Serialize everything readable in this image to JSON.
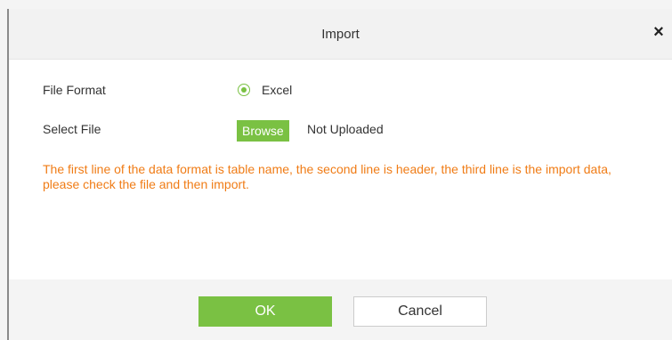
{
  "dialog": {
    "title": "Import",
    "close_symbol": "×"
  },
  "form": {
    "file_format": {
      "label": "File Format",
      "options": [
        {
          "label": "Excel",
          "selected": true
        }
      ]
    },
    "select_file": {
      "label": "Select File",
      "browse_label": "Browse",
      "status": "Not Uploaded"
    }
  },
  "hint": "The first line of the data format is table name, the second line is header, the third line is the import data, please check the file and then import.",
  "footer": {
    "ok_label": "OK",
    "cancel_label": "Cancel"
  },
  "colors": {
    "accent": "#7ac143",
    "hint": "#f07c16"
  }
}
